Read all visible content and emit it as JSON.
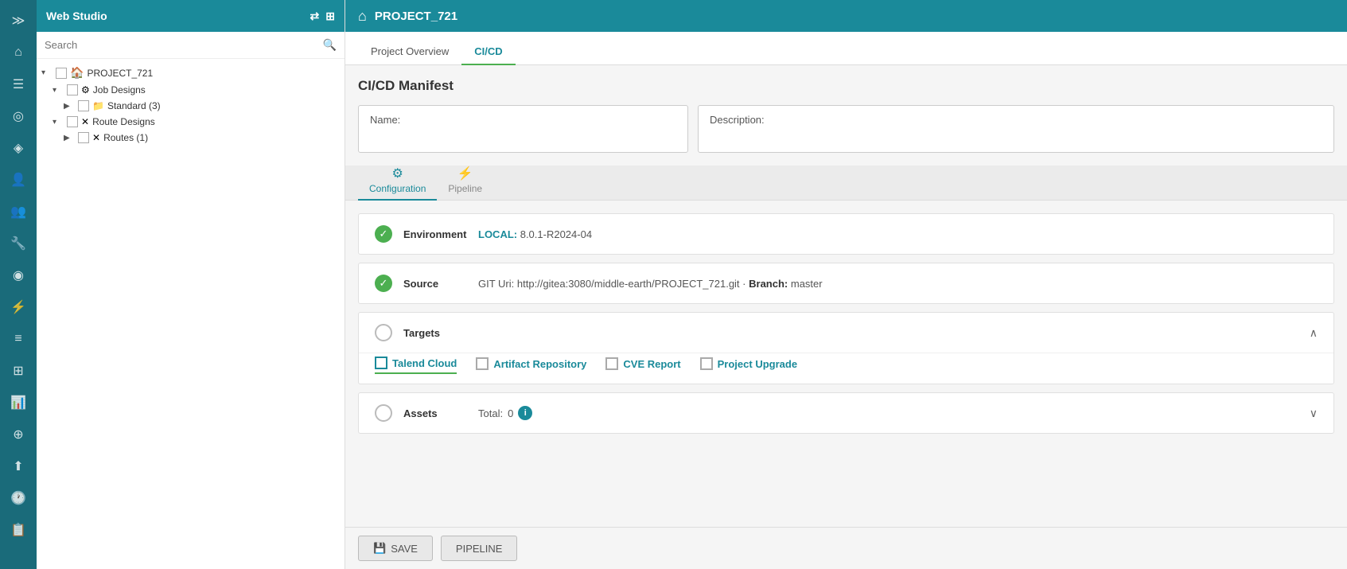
{
  "app": {
    "title": "Web Studio"
  },
  "rail": {
    "icons": [
      {
        "name": "expand-icon",
        "symbol": "≫"
      },
      {
        "name": "home-nav-icon",
        "symbol": "⌂"
      },
      {
        "name": "file-nav-icon",
        "symbol": "📄"
      },
      {
        "name": "globe-nav-icon",
        "symbol": "🌐"
      },
      {
        "name": "tag-nav-icon",
        "symbol": "🏷"
      },
      {
        "name": "person-nav-icon",
        "symbol": "👤"
      },
      {
        "name": "group-nav-icon",
        "symbol": "👥"
      },
      {
        "name": "tools-nav-icon",
        "symbol": "🔧"
      },
      {
        "name": "badge-nav-icon",
        "symbol": "🔖"
      },
      {
        "name": "lightning-nav-icon",
        "symbol": "⚡"
      },
      {
        "name": "chart-nav-icon",
        "symbol": "📊"
      },
      {
        "name": "grid-nav-icon",
        "symbol": "⊞"
      },
      {
        "name": "bar-chart-nav-icon",
        "symbol": "📈"
      },
      {
        "name": "globe2-nav-icon",
        "symbol": "🌍"
      },
      {
        "name": "upload-nav-icon",
        "symbol": "⬆"
      },
      {
        "name": "clock-nav-icon",
        "symbol": "🕐"
      },
      {
        "name": "clipboard-nav-icon",
        "symbol": "📋"
      }
    ]
  },
  "sidebar": {
    "title": "Web Studio",
    "search_placeholder": "Search",
    "tree": [
      {
        "id": "root",
        "level": 0,
        "arrow": "▾",
        "has_checkbox": true,
        "icon": "🏠",
        "label": "PROJECT_721",
        "indent": 0
      },
      {
        "id": "job_designs",
        "level": 1,
        "arrow": "▾",
        "has_checkbox": true,
        "icon": "⚙",
        "label": "Job Designs",
        "indent": 14
      },
      {
        "id": "standard",
        "level": 2,
        "arrow": "▶",
        "has_checkbox": true,
        "icon": "📁",
        "label": "Standard (3)",
        "indent": 28
      },
      {
        "id": "route_designs",
        "level": 1,
        "arrow": "▾",
        "has_checkbox": true,
        "icon": "✕",
        "label": "Route Designs",
        "indent": 14
      },
      {
        "id": "routes",
        "level": 2,
        "arrow": "▶",
        "has_checkbox": true,
        "icon": "✕",
        "label": "Routes (1)",
        "indent": 28
      }
    ]
  },
  "main": {
    "header_title": "PROJECT_721",
    "tabs": [
      {
        "id": "project-overview",
        "label": "Project Overview",
        "active": false
      },
      {
        "id": "cicd",
        "label": "CI/CD",
        "active": true
      }
    ],
    "manifest": {
      "title": "CI/CD Manifest",
      "name_label": "Name:",
      "name_value": "",
      "desc_label": "Description:",
      "desc_value": ""
    },
    "sub_tabs": [
      {
        "id": "configuration",
        "icon": "⚙",
        "label": "Configuration",
        "active": true
      },
      {
        "id": "pipeline",
        "icon": "⚡",
        "label": "Pipeline",
        "active": false
      }
    ],
    "environment": {
      "label": "Environment",
      "highlight": "LOCAL:",
      "version": "8.0.1-R2024-04"
    },
    "source": {
      "label": "Source",
      "git_label": "GIT Uri:",
      "git_uri": "http://gitea:3080/middle-earth/PROJECT_721.git",
      "branch_label": "Branch:",
      "branch_value": "master"
    },
    "targets": {
      "label": "Targets",
      "chevron": "⌃",
      "items": [
        {
          "id": "talend-cloud",
          "label": "Talend Cloud",
          "checked": false,
          "active": true
        },
        {
          "id": "artifact-repository",
          "label": "Artifact Repository",
          "checked": false,
          "active": false
        },
        {
          "id": "cve-report",
          "label": "CVE Report",
          "checked": false,
          "active": false
        },
        {
          "id": "project-upgrade",
          "label": "Project Upgrade",
          "checked": false,
          "active": false
        }
      ]
    },
    "assets": {
      "label": "Assets",
      "total_label": "Total:",
      "total_value": "0",
      "chevron": "⌄"
    },
    "footer": {
      "save_label": "SAVE",
      "pipeline_label": "PIPELINE",
      "save_icon": "💾",
      "pipeline_icon": "▶"
    }
  }
}
